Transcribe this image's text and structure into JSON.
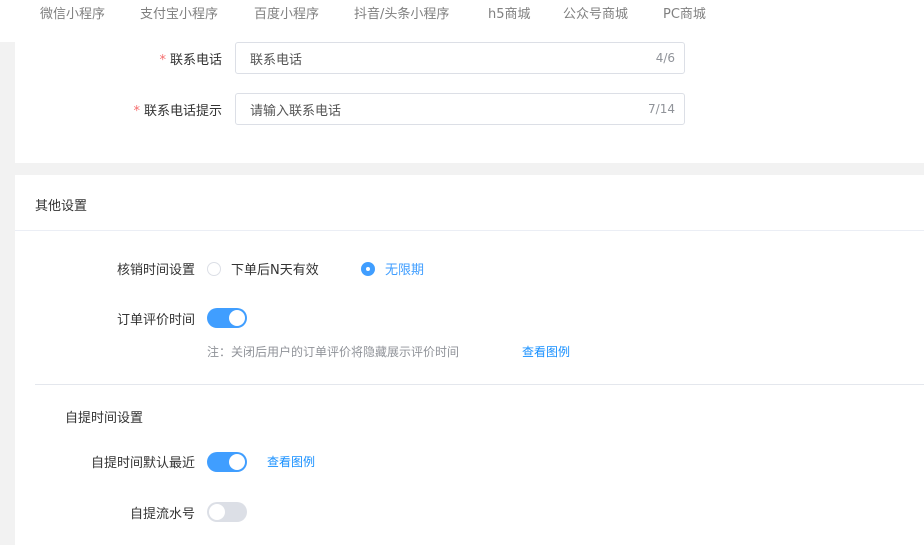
{
  "topnav": {
    "tabs": [
      {
        "label": "微信小程序"
      },
      {
        "label": "支付宝小程序"
      },
      {
        "label": "百度小程序"
      },
      {
        "label": "抖音/头条小程序"
      },
      {
        "label": "h5商城"
      },
      {
        "label": "公众号商城"
      },
      {
        "label": "PC商城"
      }
    ]
  },
  "contact": {
    "required_mark": "*",
    "phone_label": "联系电话",
    "phone_value": "联系电话",
    "phone_count": "4/6",
    "hint_label": "联系电话提示",
    "hint_value": "请输入联系电话",
    "hint_count": "7/14"
  },
  "other": {
    "section_title": "其他设置",
    "verify_label": "核销时间设置",
    "verify_options": [
      {
        "label": "下单后N天有效",
        "checked": false
      },
      {
        "label": "无限期",
        "checked": true
      }
    ],
    "review_label": "订单评价时间",
    "review_on": true,
    "review_note": "注：关闭后用户的订单评价将隐藏展示评价时间",
    "review_link": "查看图例",
    "pickup_title": "自提时间设置",
    "pickup_default_label": "自提时间默认最近",
    "pickup_default_on": true,
    "pickup_link": "查看图例",
    "serial_label": "自提流水号",
    "serial_on": false
  },
  "colors": {
    "primary": "#409eff",
    "link": "#1890ff",
    "required": "#f56c6c",
    "switch_off": "#dcdfe6"
  }
}
